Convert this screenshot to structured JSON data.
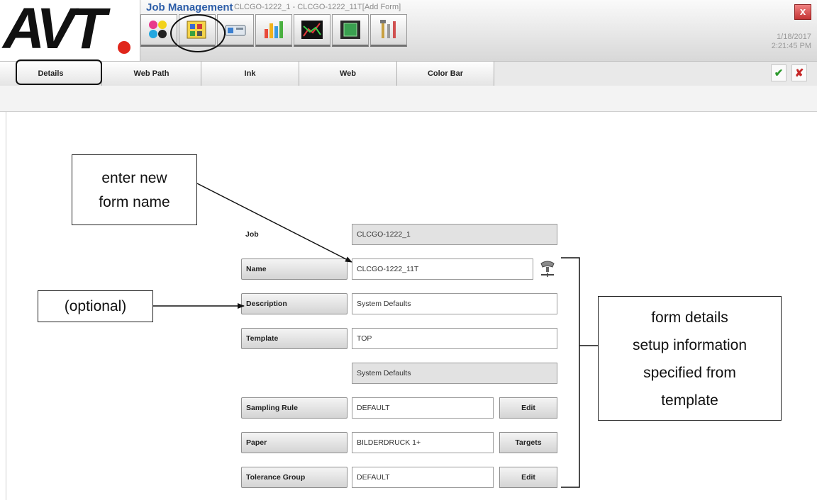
{
  "header": {
    "logo": "AVT",
    "title": "Job Management",
    "subtitle": "CLCGO-1222_1 - CLCGO-1222_11T[Add Form]",
    "date": "1/18/2017",
    "time": "2:21:45 PM",
    "close_icon": "x"
  },
  "toolbar_icons": [
    "ink-colors-icon",
    "job-form-icon",
    "press-icon",
    "bar-chart-icon",
    "graph-icon",
    "monitor-icon",
    "tools-icon"
  ],
  "tabs": {
    "details": "Details",
    "web_path": "Web Path",
    "ink": "Ink",
    "web": "Web",
    "color_bar": "Color Bar"
  },
  "actions": {
    "accept": "✔",
    "cancel": "✘"
  },
  "form": {
    "job_label": "Job",
    "job_value": "CLCGO-1222_1",
    "name_label": "Name",
    "name_value": "CLCGO-1222_11T",
    "description_label": "Description",
    "description_value": "System Defaults",
    "template_label": "Template",
    "template_value": "TOP",
    "template_desc_value": "System Defaults",
    "sampling_rule_label": "Sampling Rule",
    "sampling_rule_value": "DEFAULT",
    "sampling_rule_button": "Edit",
    "paper_label": "Paper",
    "paper_value": "BILDERDRUCK 1+",
    "paper_button": "Targets",
    "tolerance_group_label": "Tolerance Group",
    "tolerance_group_value": "DEFAULT",
    "tolerance_group_button": "Edit"
  },
  "annotations": {
    "new_name_line1": "enter new",
    "new_name_line2": "form name",
    "optional": "(optional)",
    "details_line1": "form details",
    "details_line2": "setup information",
    "details_line3": "specified from",
    "details_line4": "template"
  },
  "colors": {
    "title_blue": "#2c5da8",
    "logo_red": "#e0261b",
    "accept_green": "#2e9a2e",
    "cancel_red": "#c62828"
  }
}
